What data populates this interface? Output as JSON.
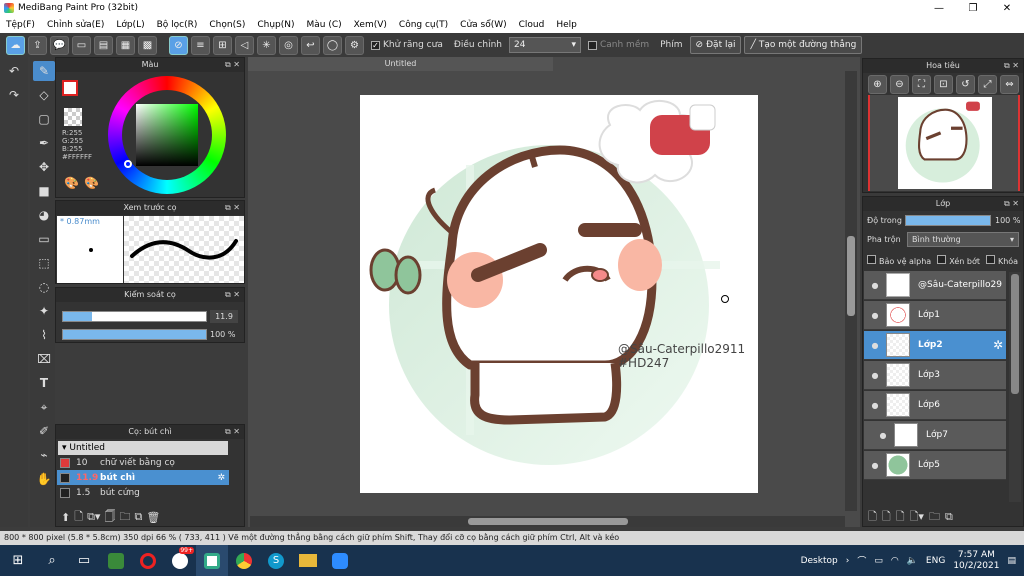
{
  "window": {
    "title": "MediBang Paint Pro (32bit)",
    "min": "—",
    "max": "❐",
    "close": "✕"
  },
  "menu": [
    "Tệp(F)",
    "Chỉnh sửa(E)",
    "Lớp(L)",
    "Bộ lọc(R)",
    "Chọn(S)",
    "Chụp(N)",
    "Màu (C)",
    "Xem(V)",
    "Công cụ(T)",
    "Cửa sổ(W)",
    "Cloud",
    "Help"
  ],
  "toolbar": {
    "antialias_label": "Khử răng cưa",
    "adjust_label": "Điều chỉnh",
    "adjust_value": "24",
    "snap_label": "Canh mềm",
    "key_label": "Phím",
    "reset_label": "Đặt lại",
    "create_line_label": "Tạo một đường thẳng"
  },
  "color_panel": {
    "title": "Màu",
    "r": "R:255",
    "g": "G:255",
    "b": "B:255",
    "hex": "#FFFFFF"
  },
  "brush_preview": {
    "title": "Xem trước cọ",
    "size": "* 0.87mm"
  },
  "brush_control": {
    "title": "Kiểm soát cọ",
    "size_value": "11.9",
    "opacity_value": "100 %",
    "size_fill": 0.2,
    "opacity_fill": 1.0
  },
  "brush_list": {
    "title": "Cọ: bút chì",
    "group": "Untitled",
    "items": [
      {
        "size": "10",
        "name": "chữ viết bằng cọ",
        "color": "#e03a3a"
      },
      {
        "size": "11.9",
        "name": "bút chì",
        "color": "#222222"
      },
      {
        "size": "1.5",
        "name": "bút cứng",
        "color": "#222222"
      }
    ]
  },
  "canvas": {
    "tab_title": "Untitled",
    "signature": "@Sâu-Caterpillo2911",
    "hashtag": "#HD247"
  },
  "navigator": {
    "title": "Hoa tiêu"
  },
  "layer_panel": {
    "title": "Lớp",
    "opacity_label": "Độ trong",
    "opacity_value": "100 %",
    "opacity_fill": 1.0,
    "blend_label": "Pha trộn",
    "blend_value": "Bình thường",
    "protect_alpha": "Bảo vệ alpha",
    "clip": "Xén bớt",
    "lock": "Khóa",
    "layers": [
      {
        "name": "@Sâu-Caterpillo29",
        "selected": false
      },
      {
        "name": "Lớp1",
        "selected": false
      },
      {
        "name": "Lớp2",
        "selected": true
      },
      {
        "name": "Lớp3",
        "selected": false
      },
      {
        "name": "Lớp6",
        "selected": false
      },
      {
        "name": "Lớp7",
        "selected": false
      },
      {
        "name": "Lớp5",
        "selected": false
      }
    ]
  },
  "status": {
    "text": "800 * 800 pixel   (5.8 * 5.8cm)   350 dpi   66 %   ( 733, 411 )   Vẽ một đường thẳng bằng cách giữ phím Shift, Thay đổi cỡ cọ bằng cách giữ phím Ctrl, Alt và kéo"
  },
  "taskbar": {
    "desktop": "Desktop",
    "lang": "ENG",
    "time": "7:57 AM",
    "date": "10/2/2021",
    "badge": "99+"
  }
}
